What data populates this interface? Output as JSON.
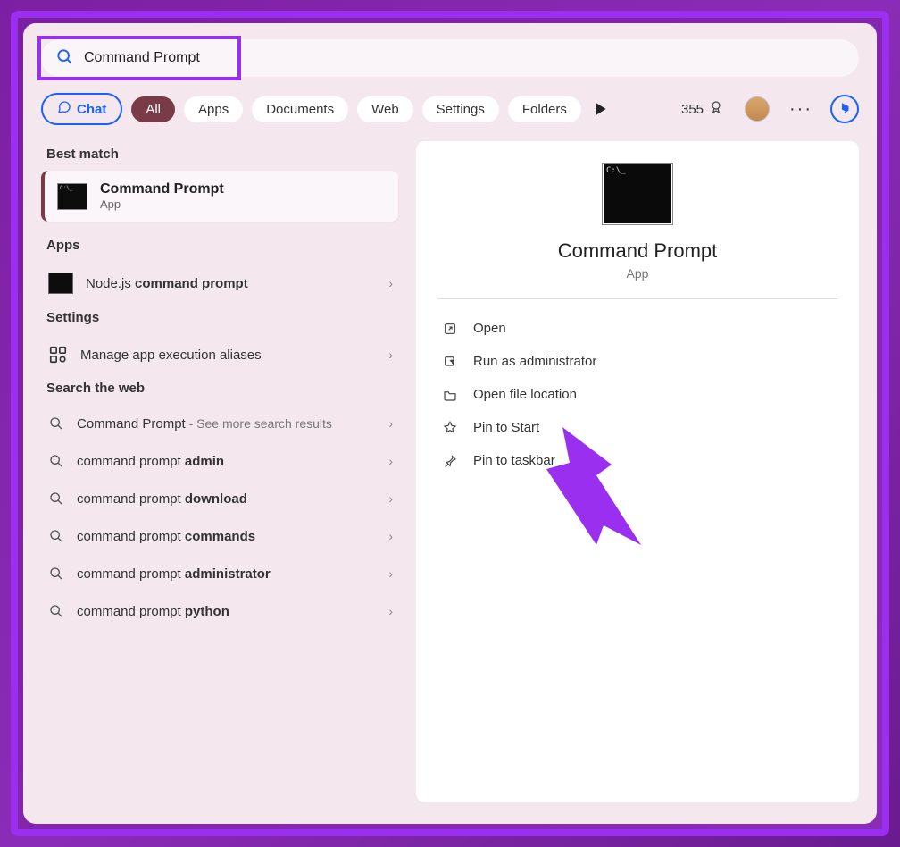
{
  "search": {
    "value": "Command Prompt"
  },
  "filters": {
    "chat": "Chat",
    "all": "All",
    "apps": "Apps",
    "documents": "Documents",
    "web": "Web",
    "settings": "Settings",
    "folders": "Folders"
  },
  "points": "355",
  "sections": {
    "best_match": "Best match",
    "apps": "Apps",
    "settings": "Settings",
    "web": "Search the web"
  },
  "best_match": {
    "title": "Command Prompt",
    "subtitle": "App"
  },
  "apps_list": {
    "item0": "Node.js command prompt"
  },
  "settings_list": {
    "item0": "Manage app execution aliases"
  },
  "web_list": {
    "item0_a": "Command Prompt",
    "item0_b": " - See more search results",
    "item1_a": "command prompt ",
    "item1_b": "admin",
    "item2_a": "command prompt ",
    "item2_b": "download",
    "item3_a": "command prompt ",
    "item3_b": "commands",
    "item4_a": "command prompt ",
    "item4_b": "administrator",
    "item5_a": "command prompt ",
    "item5_b": "python"
  },
  "preview": {
    "title": "Command Prompt",
    "subtitle": "App",
    "actions": {
      "open": "Open",
      "admin": "Run as administrator",
      "location": "Open file location",
      "pin_start": "Pin to Start",
      "pin_taskbar": "Pin to taskbar"
    }
  }
}
